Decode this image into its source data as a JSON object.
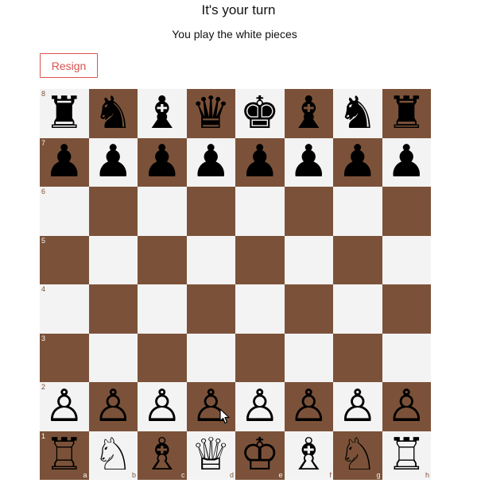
{
  "header": {
    "title": "It's your turn",
    "subtitle": "You play the white pieces"
  },
  "controls": {
    "resign_label": "Resign"
  },
  "colors": {
    "light_square": "#f4f3f3",
    "dark_square": "#7b5239",
    "resign_accent": "#d9534f"
  },
  "board": {
    "files": [
      "a",
      "b",
      "c",
      "d",
      "e",
      "f",
      "g",
      "h"
    ],
    "ranks": [
      "8",
      "7",
      "6",
      "5",
      "4",
      "3",
      "2",
      "1"
    ],
    "position": [
      [
        "black-rook",
        "black-knight",
        "black-bishop",
        "black-queen",
        "black-king",
        "black-bishop",
        "black-knight",
        "black-rook"
      ],
      [
        "black-pawn",
        "black-pawn",
        "black-pawn",
        "black-pawn",
        "black-pawn",
        "black-pawn",
        "black-pawn",
        "black-pawn"
      ],
      [
        "",
        "",
        "",
        "",
        "",
        "",
        "",
        ""
      ],
      [
        "",
        "",
        "",
        "",
        "",
        "",
        "",
        ""
      ],
      [
        "",
        "",
        "",
        "",
        "",
        "",
        "",
        ""
      ],
      [
        "",
        "",
        "",
        "",
        "",
        "",
        "",
        ""
      ],
      [
        "white-pawn",
        "white-pawn",
        "white-pawn",
        "white-pawn",
        "white-pawn",
        "white-pawn",
        "white-pawn",
        "white-pawn"
      ],
      [
        "white-rook",
        "white-knight",
        "white-bishop",
        "white-queen",
        "white-king",
        "white-bishop",
        "white-knight",
        "white-rook"
      ]
    ]
  }
}
